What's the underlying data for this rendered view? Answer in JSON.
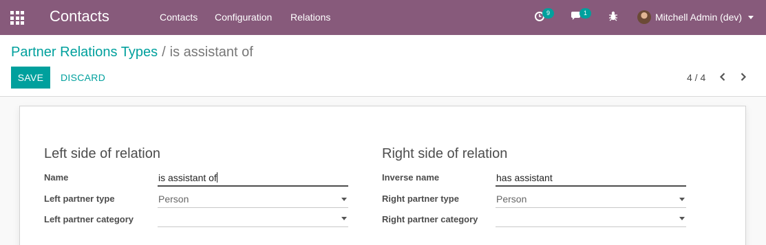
{
  "navbar": {
    "brand": "Contacts",
    "menu": [
      "Contacts",
      "Configuration",
      "Relations"
    ],
    "activity_count": "9",
    "message_count": "1",
    "user_name": "Mitchell Admin (dev)"
  },
  "breadcrumb": {
    "parent": "Partner Relations Types",
    "separator": "/",
    "current": "is assistant of"
  },
  "toolbar": {
    "save_label": "SAVE",
    "discard_label": "DISCARD"
  },
  "pager": {
    "value": "4 / 4"
  },
  "form": {
    "left_title": "Left side of relation",
    "right_title": "Right side of relation",
    "left": {
      "name_label": "Name",
      "name_value": "is assistant of",
      "type_label": "Left partner type",
      "type_value": "Person",
      "category_label": "Left partner category",
      "category_value": ""
    },
    "right": {
      "name_label": "Inverse name",
      "name_value": "has assistant",
      "type_label": "Right partner type",
      "type_value": "Person",
      "category_label": "Right partner category",
      "category_value": ""
    }
  },
  "colors": {
    "navbar": "#875a7b",
    "accent": "#00a09d"
  },
  "icons": {
    "apps": "apps-grid-icon",
    "activity": "clock-icon",
    "messages": "chat-icon",
    "debug": "bug-icon",
    "pager_prev": "chevron-left-icon",
    "pager_next": "chevron-right-icon"
  }
}
